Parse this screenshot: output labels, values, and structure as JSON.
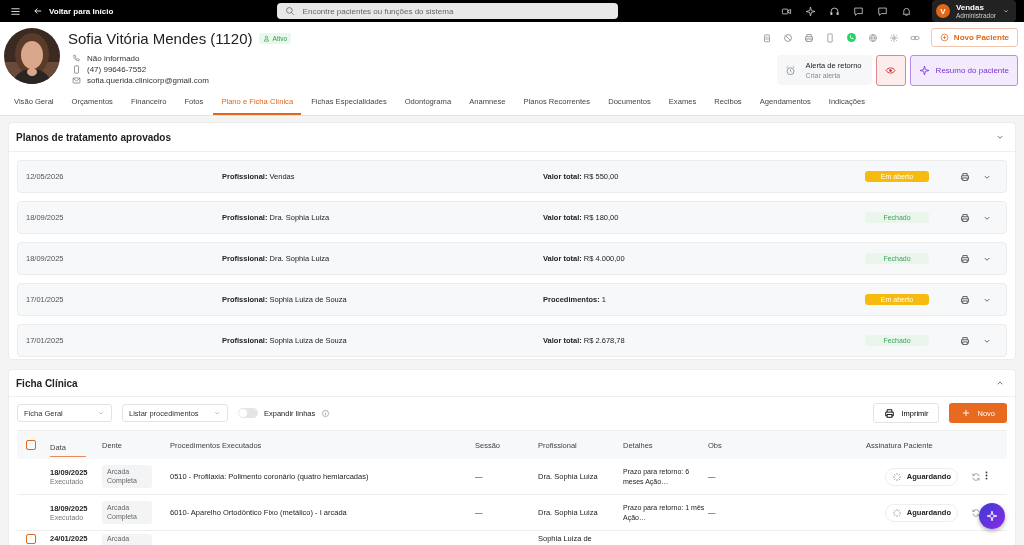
{
  "topbar": {
    "back": "Voltar para Início",
    "search": {
      "placeholder": "Encontre pacientes ou funções do sistema"
    },
    "user": {
      "initial": "V",
      "name": "Vendas",
      "role": "Administrador"
    }
  },
  "patient": {
    "name": "Sofia Vitória Mendes (1120)",
    "status": "Ativo",
    "contacts": [
      {
        "kind": "phone",
        "text": "Não informado"
      },
      {
        "kind": "mobile",
        "text": "(47) 99646-7552"
      },
      {
        "kind": "email",
        "text": "sofia.querida.clinicorp@gmail.com"
      }
    ],
    "new_patient": "Novo Paciente",
    "alert": {
      "title": "Alerta de retorno",
      "subtitle": "Criar alerta"
    },
    "summary": "Resumo do paciente"
  },
  "tabs": [
    {
      "label": "Visão Geral",
      "selected": false
    },
    {
      "label": "Orçamentos",
      "selected": false
    },
    {
      "label": "Financeiro",
      "selected": false
    },
    {
      "label": "Fotos",
      "selected": false
    },
    {
      "label": "Plano e Ficha Clínica",
      "selected": true
    },
    {
      "label": "Fichas Especialidades",
      "selected": false
    },
    {
      "label": "Odontograma",
      "selected": false
    },
    {
      "label": "Anamnese",
      "selected": false
    },
    {
      "label": "Planos Recorrentes",
      "selected": false
    },
    {
      "label": "Documentos",
      "selected": false
    },
    {
      "label": "Exames",
      "selected": false
    },
    {
      "label": "Recibos",
      "selected": false
    },
    {
      "label": "Agendamentos",
      "selected": false
    },
    {
      "label": "Indicações",
      "selected": false
    }
  ],
  "plans": {
    "title": "Planos de tratamento aprovados",
    "rows": [
      {
        "date": "12/05/2026",
        "professional": "**Profissional:** Vendas",
        "summary": "**Valor total:** R$ 550,00",
        "status": "Em aberto",
        "kind": "open"
      },
      {
        "date": "18/09/2025",
        "professional": "**Profissional:** Dra. Sophia Luiza",
        "summary": "**Valor total:** R$ 180,00",
        "status": "Fechado",
        "kind": "closed"
      },
      {
        "date": "18/09/2025",
        "professional": "**Profissional:** Dra. Sophia Luiza",
        "summary": "**Valor total:** R$ 4.000,00",
        "status": "Fechado",
        "kind": "closed"
      },
      {
        "date": "17/01/2025",
        "professional": "**Profissional:** Sophia Luiza de Souza",
        "summary": "**Procedimentos:** 1",
        "status": "Em aberto",
        "kind": "open"
      },
      {
        "date": "17/01/2025",
        "professional": "**Profissional:** Sophia Luiza de Souza",
        "summary": "**Valor total:** R$ 2.678,78",
        "status": "Fechado",
        "kind": "closed"
      }
    ]
  },
  "clinical": {
    "title": "Ficha Clínica",
    "all_checked": false,
    "filters": [
      "Ficha Geral",
      "Listar procedimentos"
    ],
    "toggle": {
      "label": "Expandir linhas",
      "on": false
    },
    "print": "Imprimir",
    "new": "Novo",
    "columns": [
      "Data",
      "Dente",
      "Procedimentos Executados",
      "Sessão",
      "Profissional",
      "Detalhes",
      "Obs",
      "Assinatura Paciente"
    ],
    "rows": [
      {
        "date": "18/09/2025",
        "state": "Executado",
        "tooth": "Arcada Completa",
        "procedure": "0510 - Profilaxia: Polimento coronário (quatro hemiarcadas)",
        "session": "—",
        "professional": "Dra. Sophia Luiza",
        "details": "Prazo para retorno: 6 meses Ação…",
        "obs": "—",
        "signature": "Aguardando",
        "more_menu": true
      },
      {
        "date": "18/09/2025",
        "state": "Executado",
        "tooth": "Arcada Completa",
        "procedure": "6010- Aparelho Ortodôntico Fixo (metálico) - I arcada",
        "session": "—",
        "professional": "Dra. Sophia Luiza",
        "details": "Prazo para retorno: 1 mês Ação…",
        "obs": "—",
        "signature": "Aguardando"
      },
      {
        "date": "24/01/2025",
        "tooth": "Arcada",
        "professional": "Sophia Luiza de",
        "checked": false
      }
    ]
  }
}
